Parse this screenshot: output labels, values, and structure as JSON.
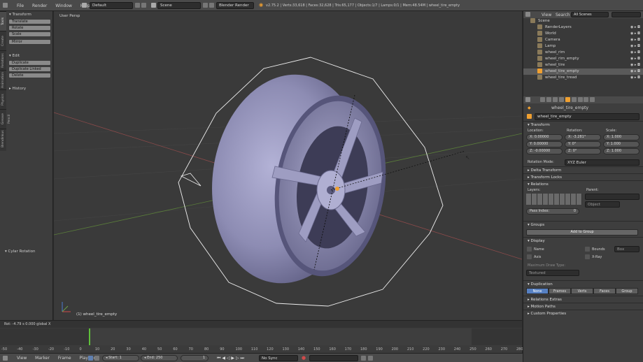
{
  "topbar": {
    "menus": [
      "File",
      "Render",
      "Window",
      "Help"
    ],
    "screen_layout": "Default",
    "scene": "Scene",
    "engine": "Blender Render",
    "stats": "v2.75.2 | Verts:33,618 | Faces:32,628 | Tris:65,177 | Objects:1/7 | Lamps:0/1 | Mem:48.54M | wheel_tire_empty"
  },
  "toolshelf": {
    "tabs": [
      "Tools",
      "Create",
      "Relations",
      "Animation",
      "Physics",
      "Grease Pencil",
      "Blendinkus"
    ],
    "transform_header": "Transform",
    "transform_buttons": [
      "Translate",
      "Rotate",
      "Scale",
      "Mirror"
    ],
    "edit_header": "Edit",
    "edit_buttons": [
      "Duplicate",
      "Duplicate Linked",
      "Delete"
    ],
    "history_header": "History",
    "operator_header": "Cylar Rotation"
  },
  "viewport": {
    "label": "User Persp",
    "object_label": "(1) wheel_tire_empty",
    "status": "Rot: -4.79 s 0.000 global X"
  },
  "timeline": {
    "ticks": [
      "-50",
      "-40",
      "-30",
      "-20",
      "-10",
      "0",
      "10",
      "20",
      "30",
      "40",
      "50",
      "60",
      "70",
      "80",
      "90",
      "100",
      "110",
      "120",
      "130",
      "140",
      "150",
      "160",
      "170",
      "180",
      "190",
      "200",
      "210",
      "220",
      "230",
      "240",
      "250",
      "260",
      "270",
      "280"
    ],
    "menus": [
      "View",
      "Marker",
      "Frame",
      "Playback"
    ],
    "start_label": "Start:",
    "start": "1",
    "end_label": "End:",
    "end": "250",
    "current": "1",
    "sync": "No Sync"
  },
  "outliner": {
    "menus": [
      "View",
      "Search"
    ],
    "filter": "All Scenes",
    "items": [
      {
        "name": "Scene",
        "indent": 0,
        "selected": false
      },
      {
        "name": "RenderLayers",
        "indent": 1,
        "selected": false
      },
      {
        "name": "World",
        "indent": 1,
        "selected": false
      },
      {
        "name": "Camera",
        "indent": 1,
        "selected": false
      },
      {
        "name": "Lamp",
        "indent": 1,
        "selected": false
      },
      {
        "name": "wheel_rim",
        "indent": 1,
        "selected": false
      },
      {
        "name": "wheel_rim_empty",
        "indent": 1,
        "selected": false
      },
      {
        "name": "wheel_tire",
        "indent": 1,
        "selected": false
      },
      {
        "name": "wheel_tire_empty",
        "indent": 1,
        "selected": true
      },
      {
        "name": "wheel_tire_tread",
        "indent": 1,
        "selected": false
      }
    ]
  },
  "props": {
    "breadcrumb": "wheel_tire_empty",
    "object_name": "wheel_tire_empty",
    "transform": {
      "header": "Transform",
      "location_label": "Location:",
      "rotation_label": "Rotation:",
      "scale_label": "Scale:",
      "location": [
        "X: 0.00000",
        "Y: 0.00000",
        "Z: -0.00000"
      ],
      "rotation": [
        "X: -3.281°",
        "Y: 0°",
        "Z: 0°"
      ],
      "scale": [
        "X: 1.000",
        "Y: 1.000",
        "Z: 1.000"
      ],
      "rotation_mode_label": "Rotation Mode:",
      "rotation_mode": "XYZ Euler"
    },
    "delta_header": "Delta Transform",
    "locks_header": "Transform Locks",
    "relations": {
      "header": "Relations",
      "layers_label": "Layers:",
      "parent_label": "Parent:",
      "pass_index": "Pass Index:",
      "pass_value": "0",
      "parent_type": "Object"
    },
    "groups": {
      "header": "Groups",
      "button": "Add to Group"
    },
    "display": {
      "header": "Display",
      "name": "Name",
      "axis": "Axis",
      "bounds": "Bounds",
      "xray": "X-Ray",
      "bounds_type": "Box",
      "max_draw_label": "Maximum Draw Type:",
      "max_draw": "Textured"
    },
    "duplication": {
      "header": "Duplication",
      "options": [
        "None",
        "Frames",
        "Verts",
        "Faces",
        "Group"
      ],
      "active": "None"
    },
    "relations_extras": "Relations Extras",
    "motion_paths": "Motion Paths",
    "custom_properties": "Custom Properties"
  },
  "colors": {
    "accent": "#5680c2",
    "selected_orange": "#f0a030"
  }
}
